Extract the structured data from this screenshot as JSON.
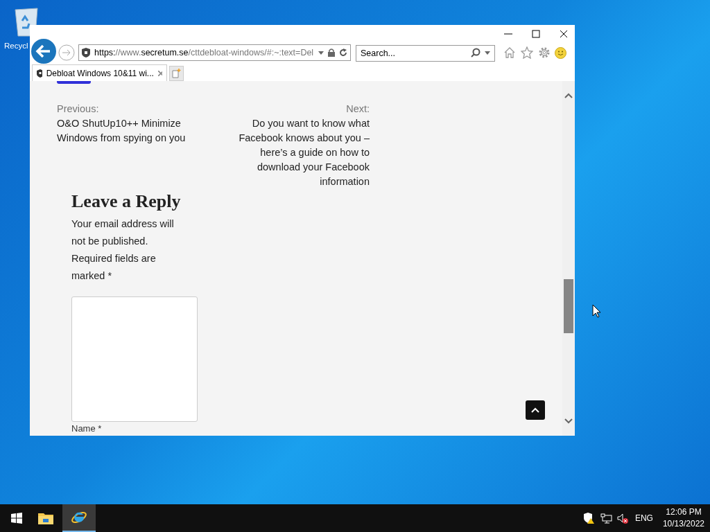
{
  "desktop": {
    "icons": [
      {
        "label": "Recycl"
      }
    ]
  },
  "browser": {
    "address": {
      "scheme": "https:",
      "host_prefix": "//www.",
      "domain": "secretum.se",
      "path": "/cttdebloat-windows/#:~:text=Del"
    },
    "search": {
      "placeholder": "Search..."
    },
    "tabs": [
      {
        "label": "Debloat Windows 10&11 wi...",
        "selected": true
      }
    ],
    "page": {
      "previous": {
        "label": "Previous:",
        "title": "O&O ShutUp10++ Minimize Windows from spying on you"
      },
      "next": {
        "label": "Next:",
        "title": "Do you want to know what Facebook knows about you – here’s a guide on how to download your Facebook information"
      },
      "reply_heading": "Leave a Reply",
      "notice": "Your email address will not be published. Required fields are marked *",
      "name_label": "Name *"
    }
  },
  "taskbar": {
    "apps": [
      {
        "kind": "explorer",
        "selected": false
      },
      {
        "kind": "ie",
        "selected": true
      }
    ],
    "language": "ENG",
    "time": "12:06 PM",
    "date": "10/13/2022"
  }
}
